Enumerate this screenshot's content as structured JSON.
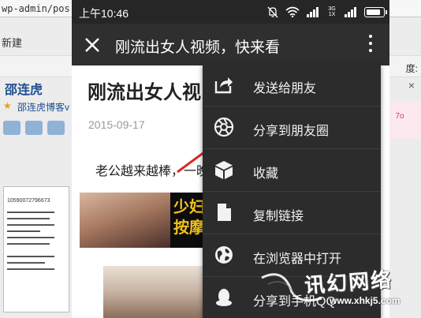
{
  "background": {
    "url_fragment": "wp-admin/pos",
    "new_tab": "新建",
    "username": "邵连虎",
    "blog_link": "邵连虎博客v",
    "doc_id": "10590072796673",
    "right_text": "度:",
    "right_close": "×",
    "badge": "7o"
  },
  "status_bar": {
    "time": "上午10:46",
    "network": "3G 1X"
  },
  "title_bar": {
    "title": "刚流出女人视频，快来看"
  },
  "article": {
    "title": "刚流出女人视",
    "date": "2015-09-17",
    "text": "老公越来越棒，一晚",
    "image_text": "少妇\n按摩"
  },
  "menu": {
    "items": [
      {
        "label": "发送给朋友",
        "icon": "share-arrow-icon"
      },
      {
        "label": "分享到朋友圈",
        "icon": "moments-aperture-icon"
      },
      {
        "label": "收藏",
        "icon": "favorite-cube-icon"
      },
      {
        "label": "复制链接",
        "icon": "copy-document-icon"
      },
      {
        "label": "在浏览器中打开",
        "icon": "browser-globe-icon"
      },
      {
        "label": "分享到手机QQ",
        "icon": "qq-penguin-icon"
      }
    ]
  },
  "watermark": {
    "text": "讯幻网络",
    "url": "www.xhkj5.com"
  },
  "colors": {
    "status_bar": "#262626",
    "title_bar": "#2f2f2f",
    "menu_bg": "#2c2c2c",
    "arrow": "#e0252b"
  }
}
